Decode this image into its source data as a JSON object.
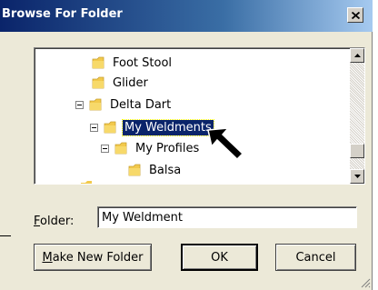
{
  "window": {
    "title": "Browse For Folder"
  },
  "tree": {
    "items": [
      {
        "label": "Foot Stool",
        "level": 1,
        "expander": false,
        "selected": false
      },
      {
        "label": "Glider",
        "level": 1,
        "expander": false,
        "selected": false
      },
      {
        "label": "Delta Dart",
        "level": 1,
        "expander": true,
        "selected": false
      },
      {
        "label": "My Weldments",
        "level": 2,
        "expander": true,
        "selected": true
      },
      {
        "label": "My Profiles",
        "level": 3,
        "expander": true,
        "selected": false
      },
      {
        "label": "Balsa",
        "level": 4,
        "expander": false,
        "selected": false
      }
    ]
  },
  "folder_field": {
    "label_mnemonic": "F",
    "label_rest": "older:",
    "value": "My Weldment"
  },
  "buttons": {
    "make_new_folder_mnemonic": "M",
    "make_new_folder_rest": "ake New Folder",
    "ok": "OK",
    "cancel": "Cancel"
  },
  "colors": {
    "titlebar_start": "#0a246a",
    "titlebar_end": "#a6caf0",
    "selection": "#0a246a",
    "dialog_bg": "#ece9d8",
    "folder_yellow": "#f2c94c"
  },
  "icons": [
    "folder-icon",
    "close-icon",
    "arrow-cursor-icon",
    "size-grip-icon"
  ]
}
